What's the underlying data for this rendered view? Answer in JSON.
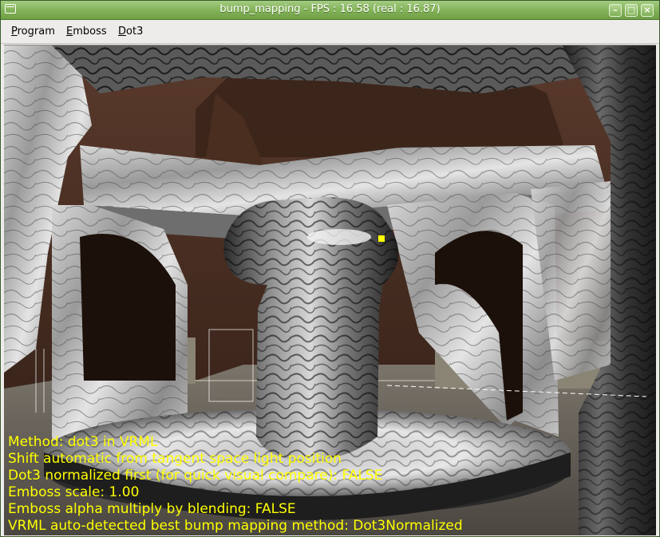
{
  "window": {
    "title": "bump_mapping - FPS : 16.58 (real : 16.87)",
    "controls": {
      "minimize": "–",
      "maximize": "□",
      "close": "×"
    }
  },
  "menubar": {
    "items": [
      "Program",
      "Emboss",
      "Dot3"
    ]
  },
  "overlay": {
    "lines": [
      "Method: dot3 in VRML",
      "Shift automatic from tangent space light position",
      "Dot3 normalized first (for quick visual compare): FALSE",
      "Emboss scale: 1.00",
      "Emboss alpha multiply by blending: FALSE",
      "VRML auto-detected best bump mapping method: Dot3Normalized"
    ],
    "color": "#ffff00"
  },
  "scene": {
    "light_marker_color": "#ffff00"
  }
}
